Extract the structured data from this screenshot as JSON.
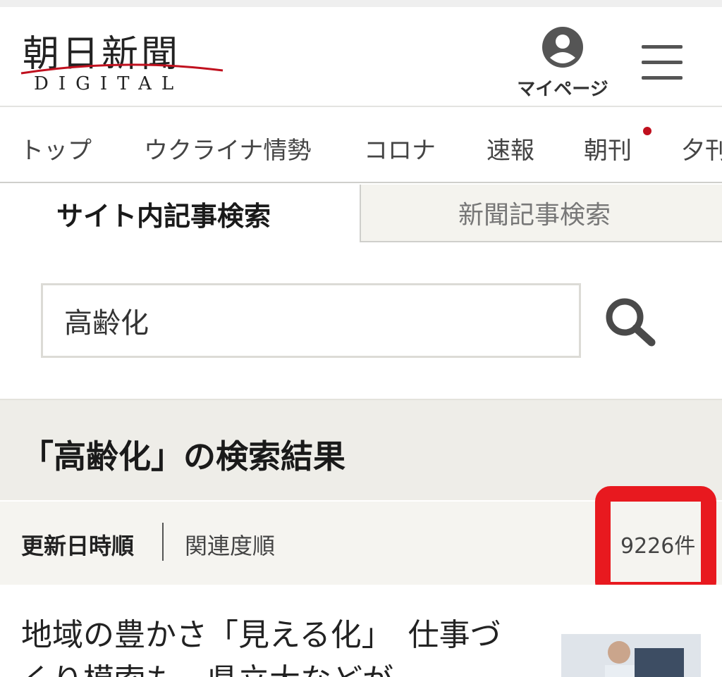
{
  "header": {
    "logo_kanji": "朝日新聞",
    "logo_subtitle": "DIGITAL",
    "mypage_label": "マイページ"
  },
  "nav": {
    "items": [
      "トップ",
      "ウクライナ情勢",
      "コロナ",
      "速報",
      "朝刊",
      "夕刊"
    ]
  },
  "tabs": {
    "active": "サイト内記事検索",
    "inactive": "新聞記事検索"
  },
  "search": {
    "value": "高齢化"
  },
  "results": {
    "heading": "「高齢化」の検索結果",
    "sort_date": "更新日時順",
    "sort_relevance": "関連度順",
    "count": "9226件"
  },
  "article": {
    "title": "地域の豊かさ「見える化」　仕事づくり模索も　県立大などが"
  },
  "colors": {
    "accent_red": "#c0101e",
    "highlight_red": "#e8191f"
  }
}
